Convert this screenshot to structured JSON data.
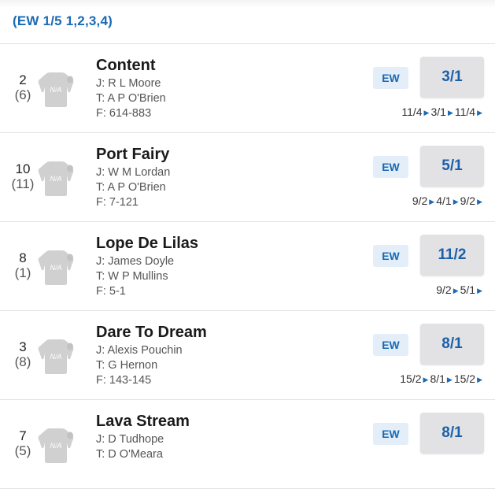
{
  "ew_terms": "(EW 1/5 1,2,3,4)",
  "silk_label": "N/A",
  "ew_label": "EW",
  "colors": {
    "accent": "#1b6ab4",
    "odds_bg": "#e2e2e4",
    "ew_bg": "#e3eef9",
    "silk": "#d0d0d0"
  },
  "runners": [
    {
      "number": "2",
      "draw": "(6)",
      "name": "Content",
      "jockey": "J: R L Moore",
      "trainer": "T: A P O'Brien",
      "form": "F: 614-883",
      "odds": "3/1",
      "history": [
        "11/4",
        "3/1",
        "11/4"
      ]
    },
    {
      "number": "10",
      "draw": "(11)",
      "name": "Port Fairy",
      "jockey": "J: W M Lordan",
      "trainer": "T: A P O'Brien",
      "form": "F: 7-121",
      "odds": "5/1",
      "history": [
        "9/2",
        "4/1",
        "9/2"
      ]
    },
    {
      "number": "8",
      "draw": "(1)",
      "name": "Lope De Lilas",
      "jockey": "J: James Doyle",
      "trainer": "T: W P Mullins",
      "form": "F: 5-1",
      "odds": "11/2",
      "history": [
        "9/2",
        "5/1"
      ]
    },
    {
      "number": "3",
      "draw": "(8)",
      "name": "Dare To Dream",
      "jockey": "J: Alexis Pouchin",
      "trainer": "T: G Hernon",
      "form": "F: 143-145",
      "odds": "8/1",
      "history": [
        "15/2",
        "8/1",
        "15/2"
      ]
    },
    {
      "number": "7",
      "draw": "(5)",
      "name": "Lava Stream",
      "jockey": "J: D Tudhope",
      "trainer": "T: D O'Meara",
      "form": "",
      "odds": "8/1",
      "history": []
    }
  ]
}
